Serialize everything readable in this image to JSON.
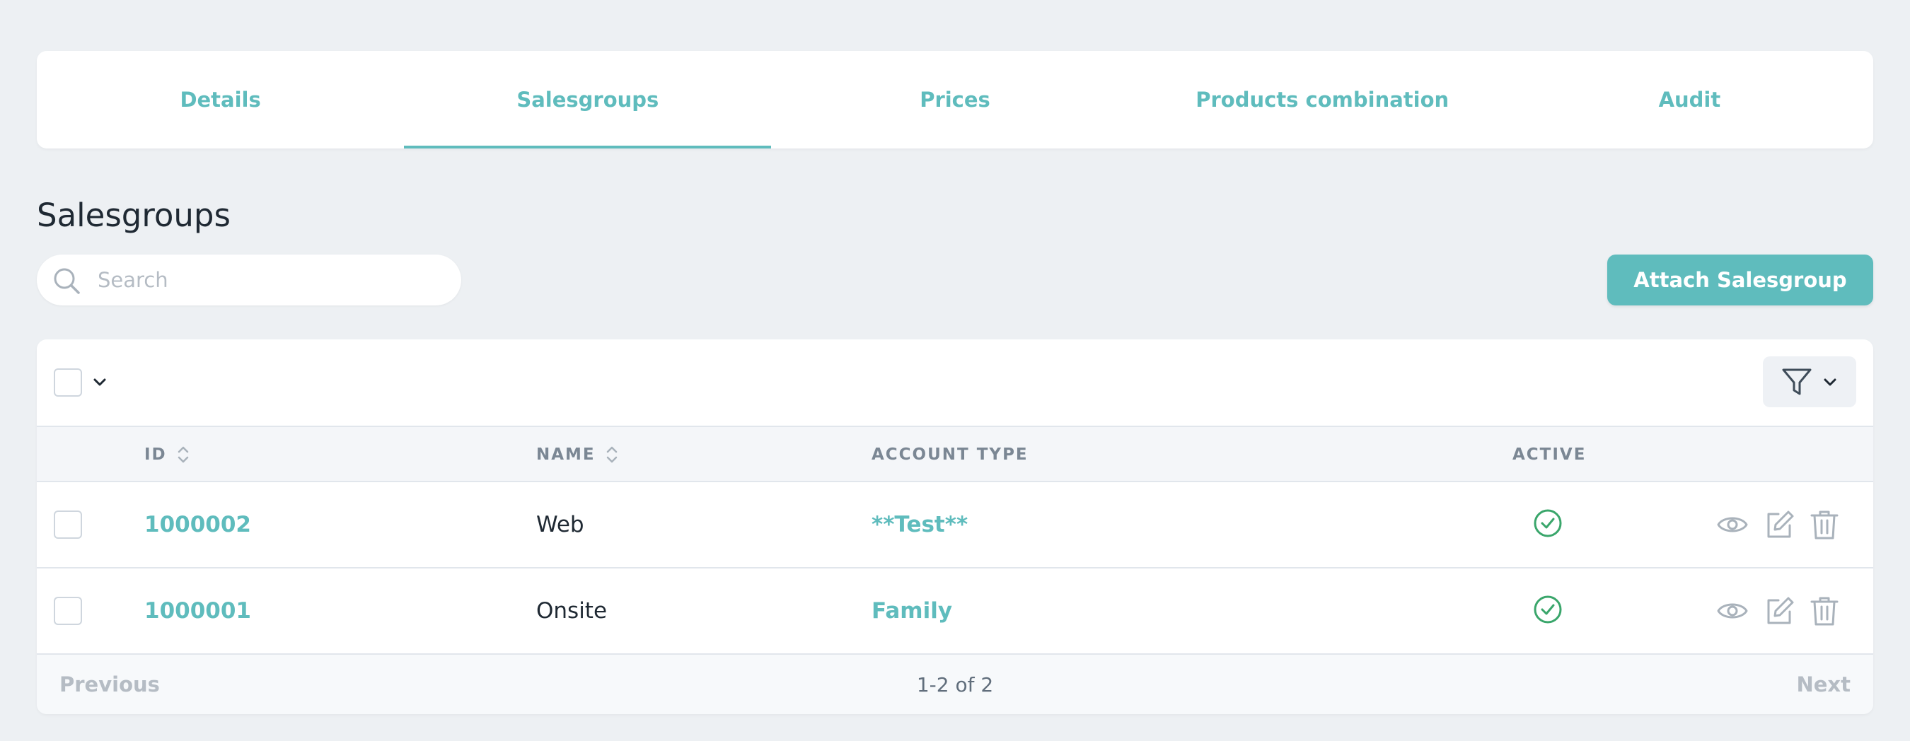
{
  "tabs": [
    {
      "label": "Details",
      "active": false
    },
    {
      "label": "Salesgroups",
      "active": true
    },
    {
      "label": "Prices",
      "active": false
    },
    {
      "label": "Products combination",
      "active": false
    },
    {
      "label": "Audit",
      "active": false
    }
  ],
  "page_title": "Salesgroups",
  "search": {
    "placeholder": "Search",
    "value": ""
  },
  "attach_button": "Attach Salesgroup",
  "table": {
    "headers": {
      "id": "ID",
      "name": "NAME",
      "account_type": "ACCOUNT TYPE",
      "active": "ACTIVE"
    },
    "rows": [
      {
        "id": "1000002",
        "name": "Web",
        "account_type": "**Test**",
        "active": true
      },
      {
        "id": "1000001",
        "name": "Onsite",
        "account_type": "Family",
        "active": true
      }
    ]
  },
  "pagination": {
    "previous": "Previous",
    "range": "1-2 of 2",
    "next": "Next"
  },
  "colors": {
    "accent": "#5fbcbd",
    "active_check": "#3aa66b",
    "icon_gray": "#a9b2bb"
  },
  "icons": [
    "search-icon",
    "chevron-down-icon",
    "filter-icon",
    "sort-icon",
    "check-circle-icon",
    "eye-icon",
    "edit-icon",
    "trash-icon"
  ]
}
